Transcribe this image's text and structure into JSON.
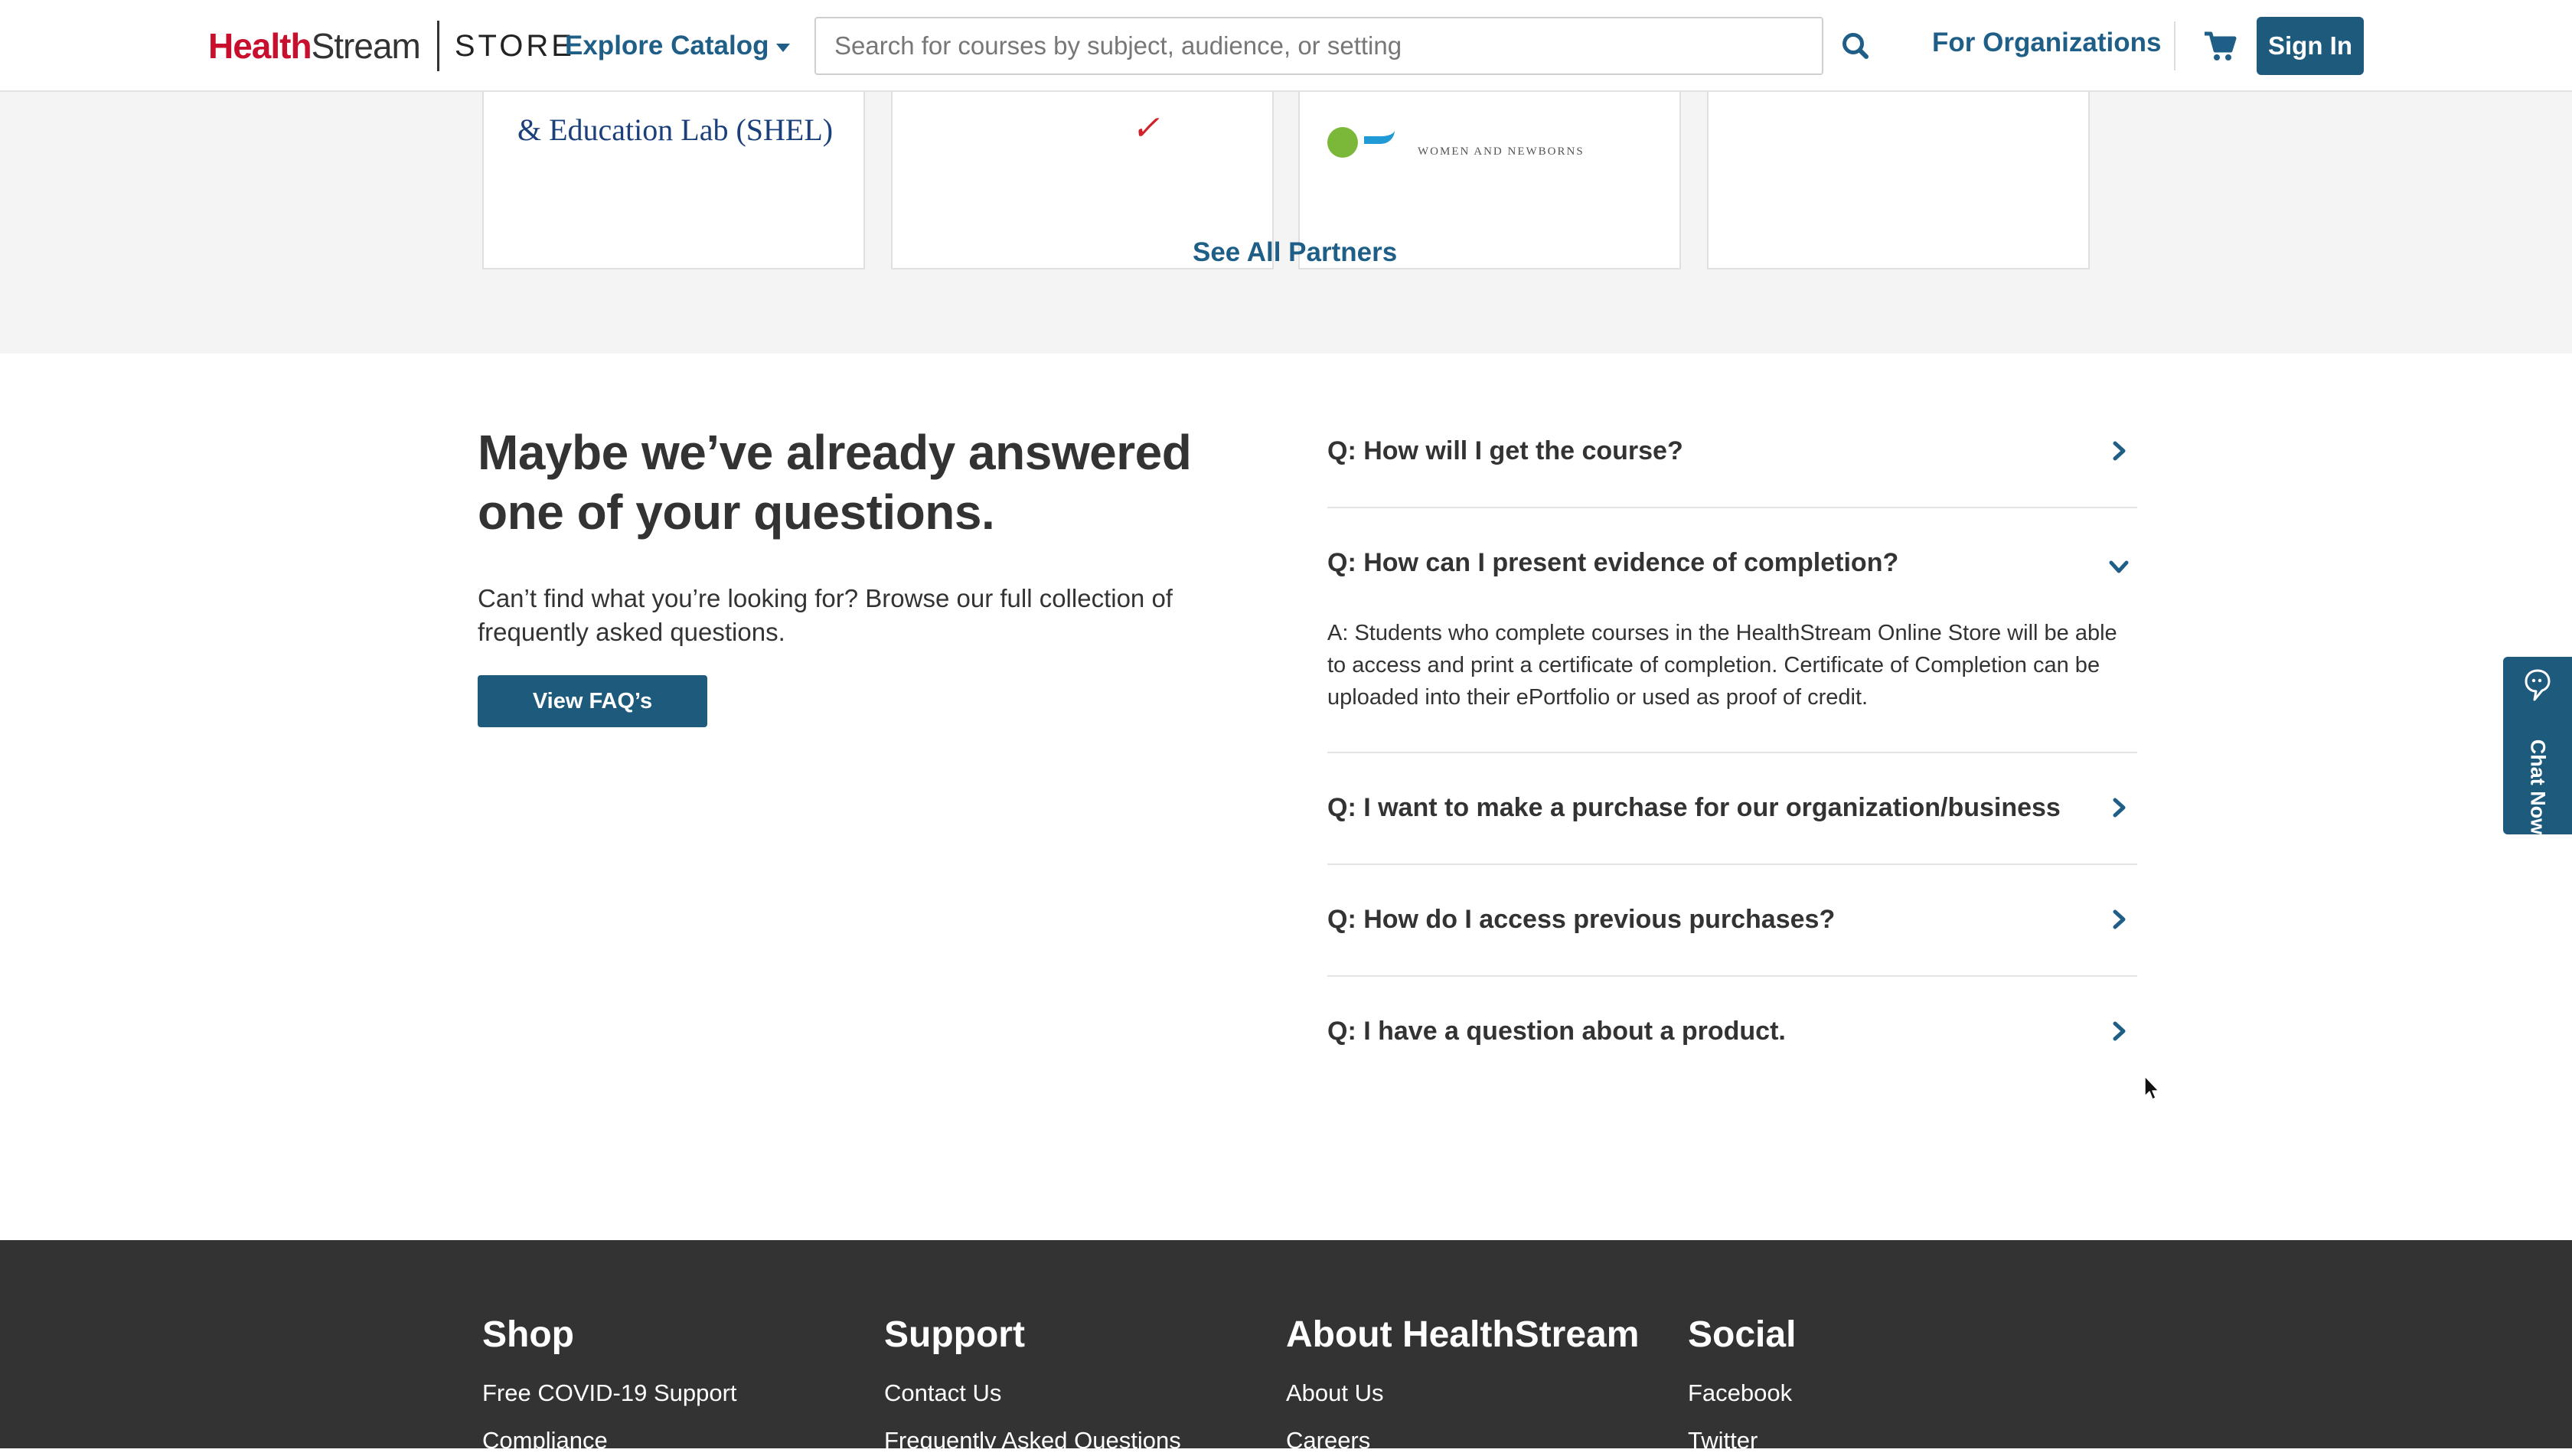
{
  "header": {
    "logo": {
      "brand_red": "Health",
      "brand_dark": "Stream",
      "store": "STORE"
    },
    "explore_label": "Explore Catalog",
    "search": {
      "placeholder": "Search for courses by subject, audience, or setting",
      "value": ""
    },
    "for_organizations": "For Organizations",
    "sign_in": "Sign In",
    "icons": {
      "search": "search-icon",
      "cart": "cart-icon",
      "explore_caret": "caret-down-icon"
    }
  },
  "partners": {
    "cards": [
      {
        "text": "& Education Lab (SHEL)"
      },
      {
        "text": "✓"
      },
      {
        "text": "WOMEN AND NEWBORNS"
      },
      {
        "text": ""
      }
    ],
    "see_all": "See All Partners"
  },
  "faq": {
    "heading": "Maybe we’ve already answered one of your questions.",
    "subtext": "Can’t find what you’re looking for? Browse our full collection of frequently asked questions.",
    "button_label": "View FAQ’s",
    "items": [
      {
        "question": "Q: How will I get the course?",
        "expanded": false,
        "answer": ""
      },
      {
        "question": "Q: How can I present evidence of completion?",
        "expanded": true,
        "answer": "A: Students who complete courses in the HealthStream Online Store will be able to access and print a certificate of completion. Certificate of Completion can be uploaded into their ePortfolio or used as proof of credit."
      },
      {
        "question": "Q: I want to make a purchase for our organization/business",
        "expanded": false,
        "answer": ""
      },
      {
        "question": "Q: How do I access previous purchases?",
        "expanded": false,
        "answer": ""
      },
      {
        "question": "Q: I have a question about a product.",
        "expanded": false,
        "answer": ""
      }
    ]
  },
  "chat": {
    "label": "Chat Now",
    "icon": "chat-bubble-icon"
  },
  "footer": {
    "columns": [
      {
        "title": "Shop",
        "links": [
          "Free COVID-19 Support",
          "Compliance"
        ]
      },
      {
        "title": "Support",
        "links": [
          "Contact Us",
          "Frequently Asked Questions"
        ]
      },
      {
        "title": "About HealthStream",
        "links": [
          "About Us",
          "Careers"
        ]
      },
      {
        "title": "Social",
        "links": [
          "Facebook",
          "Twitter"
        ]
      }
    ]
  },
  "colors": {
    "brand_red": "#c8102e",
    "link_blue": "#1f5f87",
    "button_blue": "#1d5a7c",
    "section_gray": "#f4f4f4",
    "footer_bg": "#333333",
    "text": "#333333"
  }
}
